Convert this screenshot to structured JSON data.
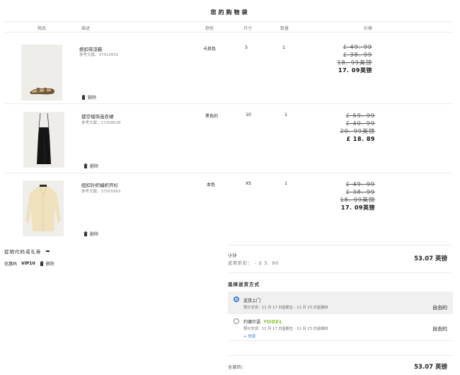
{
  "page": {
    "title": "您的购物袋"
  },
  "columns": {
    "item": "物品",
    "desc": "描述",
    "color": "颜色",
    "size": "尺寸",
    "qty": "数量",
    "price": "价格"
  },
  "items": [
    {
      "name": "搭扣带凉鞋",
      "ref": "参考文献。37010655",
      "color": "卡其色",
      "size": "5",
      "qty": "1",
      "prices_old": [
        "£ 49. 99",
        "£ 38. 99",
        "18. 99英镑"
      ],
      "price_now": "17. 09英镑",
      "delete_label": "删除"
    },
    {
      "name": "镂空褶饰连衣裙",
      "ref": "参考文献。27008638",
      "color": "黑色的",
      "size": "10",
      "qty": "1",
      "prices_old": [
        "£ 59. 99",
        "£ 40. 99",
        "20. 99英镑"
      ],
      "price_now": "£ 18. 89",
      "delete_label": "删除"
    },
    {
      "name": "纽扣针织编织开衫",
      "ref": "参考文献。37005963",
      "color": "本色",
      "size": "XS",
      "qty": "1",
      "prices_old": [
        "£ 49. 99",
        "£ 38. 99",
        "18. 99英镑"
      ],
      "price_now": "17. 09英镑",
      "delete_label": "删除"
    }
  ],
  "promo": {
    "title": "促销代码或礼券",
    "code_label": "优惠码",
    "code": "VIP10",
    "delete_label": "删除"
  },
  "summary": {
    "subtotal_label": "小计",
    "discount_label": "适用折扣：  - £ 5. 90",
    "subtotal_value": "53.07 英镑",
    "shipping_title": "选择送货方式",
    "shipping_options": [
      {
        "name": "送货上门",
        "eta": "预计交货：11 月 17 日星期五 - 11 月 23 日星期四",
        "price": "自由的",
        "selected": true
      },
      {
        "name": "约德尔语",
        "brand": "YODEL",
        "eta": "预计交货：11 月 17 日星期五 - 11 月 23 日星期四",
        "price": "自由的",
        "info": "+ 信息",
        "selected": false
      }
    ],
    "total_label": "全部的：",
    "total_value": "53.07 英镑"
  }
}
